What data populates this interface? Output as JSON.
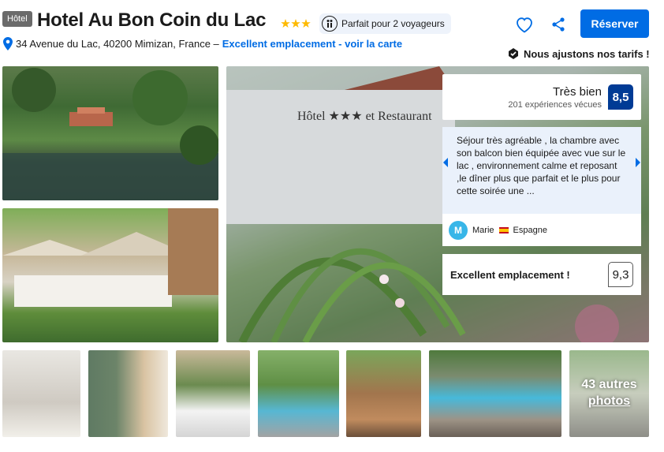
{
  "header": {
    "type_badge": "Hôtel",
    "title": "Hotel Au Bon Coin du Lac",
    "star_count": 3,
    "travelers_pill": "Parfait pour 2 voyageurs",
    "address": "34 Avenue du Lac, 40200 Mimizan, France –",
    "location_link": "Excellent emplacement - voir la carte",
    "reserve_label": "Réserver",
    "price_match": "Nous ajustons nos tarifs !"
  },
  "review": {
    "rating_label": "Très bien",
    "review_count": "201 expériences vécues",
    "score": "8,5",
    "quote": "Séjour très agréable , la chambre avec son balcon bien équipée avec vue sur le lac , environnement calme et reposant ,le dîner plus que parfait et le plus pour cette soirée une ...",
    "author_initial": "M",
    "author_name": "Marie",
    "author_country": "Espagne"
  },
  "location": {
    "label": "Excellent emplacement !",
    "score": "9,3"
  },
  "gallery": {
    "more_count": "43 autres",
    "more_label": "photos"
  },
  "colors": {
    "primary": "#006ce4",
    "score_bg": "#003b95",
    "star": "#feba02"
  }
}
